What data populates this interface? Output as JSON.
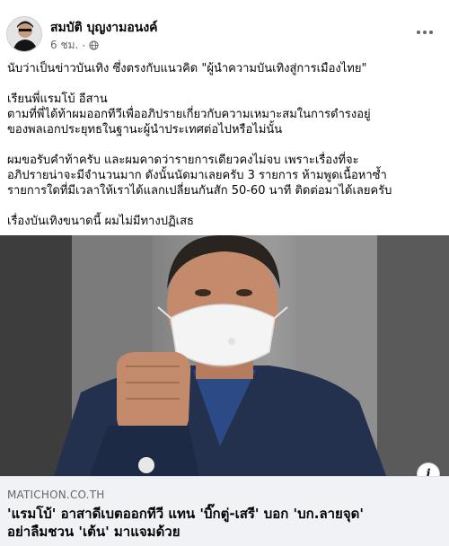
{
  "post": {
    "author": "สมบัติ บุญงามอนงค์",
    "time": "6 ชม.",
    "separator": "·",
    "privacy_icon": "globe-icon",
    "more_icon": "more-horizontal-icon",
    "lines": [
      "นับว่าเป็นข่าวบันเทิง ซึ่งตรงกับแนวคิด \"ผู้นำความบันเทิงสู่การเมืองไทย\"",
      "เรียนพี่แรมโบ้ อีสาน",
      "ตามที่พี่ได้ท้าผมออกทีวีเพื่ออภิปรายเกี่ยวกับความเหมาะสมในการดำรงอยู่",
      "ของพลเอกประยุทธในฐานะผู้นำประเทศต่อไปหรือไม่นั้น",
      "ผมขอรับคำท้าครับ และผมคาดว่ารายการเดียวคงไม่จบ เพราะเรื่องที่จะ",
      "อภิปรายน่าจะมีจำนวนมาก ดังนั้นนัดมาเลยครับ 3 รายการ ห้ามพูดเนื้อหาซ้ำ",
      "รายการใดที่มีเวลาให้เราได้แลกเปลี่ยนกันสัก 50-60 นาที ติดต่อมาได้เลยครับ",
      "เรื่องบันเทิงขนาดนี้ ผมไม่มีทางปฏิเสธ"
    ]
  },
  "link": {
    "domain": "MATICHON.CO.TH",
    "title_line1": "'แรมโบ้' อาสาดีเบตออกทีวี แทน 'บิ๊กตู่-เสรี' บอก 'บก.ลายจุด'",
    "title_line2": "อย่าลืมชวน 'เต้น' มาแจมด้วย",
    "info_icon": "info-icon",
    "info_label": "i"
  },
  "colors": {
    "jacket": "#23314f",
    "shirt": "#2b4a86",
    "mask": "#f4f4f4",
    "background_panel": "#8a8a8a"
  }
}
